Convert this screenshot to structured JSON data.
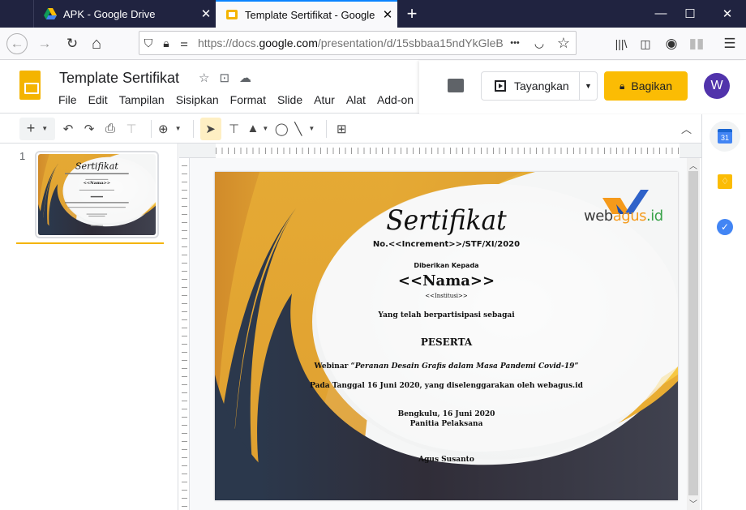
{
  "browser": {
    "tabs": [
      {
        "title": "APK - Google Drive",
        "icon": "google-drive-icon",
        "active": false
      },
      {
        "title": "Template Sertifikat - Google Slides",
        "icon": "google-slides-icon",
        "active": true
      }
    ],
    "url_prefix": "https://docs.",
    "url_domain": "google.com",
    "url_suffix": "/presentation/d/15sbbaa15ndYkGleB",
    "glyphs": {
      "new_tab": "+",
      "minimize": "—",
      "maximize": "☐",
      "close": "✕",
      "tab_close": "✕",
      "back": "←",
      "forward": "→",
      "reload": "↻",
      "home": "⌂",
      "more": "•••",
      "star": "☆",
      "menu": "☰"
    }
  },
  "app": {
    "doc_title": "Template Sertifikat",
    "menu": [
      "File",
      "Edit",
      "Tampilan",
      "Sisipkan",
      "Format",
      "Slide",
      "Atur",
      "Alat",
      "Add-on"
    ],
    "present_label": "Tayangkan",
    "share_label": "Bagikan",
    "avatar_letter": "W",
    "accent": "#fbbc04"
  },
  "filmstrip": {
    "slide_number": "1"
  },
  "sidepanel": {
    "calendar_day": "31"
  },
  "certificate": {
    "title": "Sertifikat",
    "number": "No.<<Increment>>/STF/XI/2020",
    "given_to": "Diberikan Kepada",
    "name": "<<Nama>>",
    "institution": "<<Institusi>>",
    "participated": "Yang telah berpartisipasi sebagai",
    "role": "PESERTA",
    "webinar_prefix": "Webinar “",
    "webinar_title": "Peranan Desain Grafis dalam Masa Pandemi Covid-19",
    "webinar_suffix": "”",
    "date_line": "Pada Tanggal 16 Juni 2020, yang diselenggarakan oleh webagus.id",
    "place_date": "Bengkulu, 16 Juni 2020",
    "committee": "Panitia Pelaksana",
    "signer": "Agus Susanto",
    "logo_dark": "web",
    "logo_orange": "agus",
    "logo_green": ".id"
  }
}
